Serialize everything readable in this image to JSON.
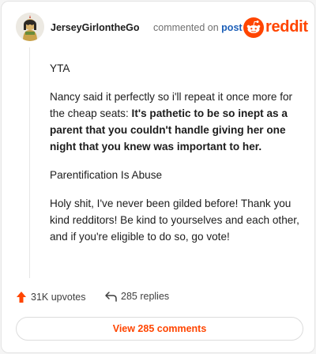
{
  "header": {
    "username": "JerseyGirlontheGo",
    "commented_on": "commented on",
    "post_link": "post",
    "brand": "reddit"
  },
  "comment": {
    "paragraphs": [
      {
        "text": "YTA"
      },
      {
        "prefix": "Nancy said it perfectly so i'll repeat it once more for the cheap seats: ",
        "bold": "It's pathetic to be so inept as a parent that you couldn't handle giving her one night that you knew was important to her."
      },
      {
        "text": "Parentification Is Abuse"
      },
      {
        "text": "Holy shit, I've never been gilded before! Thank you kind redditors! Be kind to yourselves and each other, and if you're eligible to do so, go vote!"
      }
    ]
  },
  "actions": {
    "upvotes": "31K upvotes",
    "replies": "285 replies",
    "view_comments": "View 285 comments"
  },
  "colors": {
    "accent": "#ff4500",
    "link": "#1c5fb8"
  }
}
